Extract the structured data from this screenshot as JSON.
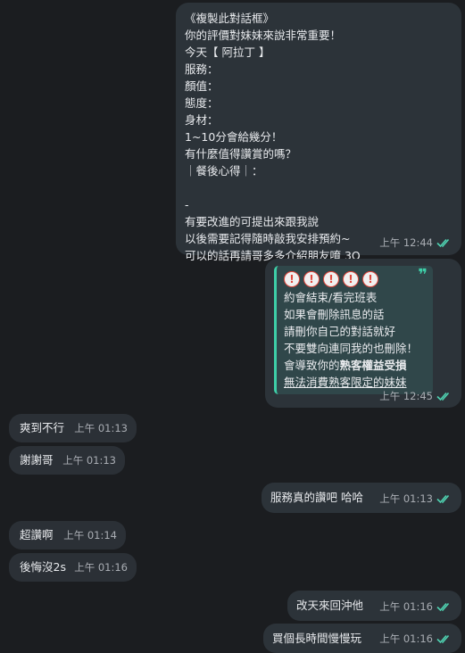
{
  "messages": [
    {
      "id": "msg1",
      "direction": "out",
      "lines": [
        "《複製此對話框》",
        "你的評價對妹妹來說非常重要！",
        "今天【 阿拉丁 】",
        "服務：",
        "顏值：",
        "態度：",
        "身材：",
        "1~10分會給幾分！",
        "有什麼值得讚賞的嗎？",
        "｜餐後心得｜：",
        "",
        "-",
        "有要改進的可提出來跟我說",
        "以後需要記得隨時敲我安排預約~",
        "可以的話再請哥多多介紹朋友唷 3Q"
      ],
      "time": "上午 12:44",
      "read": true
    },
    {
      "id": "msg2",
      "direction": "out",
      "quote_mark": "❞",
      "warn_count": 5,
      "warn_glyph": "!",
      "quote_lines": [
        "約會結束/看完班表",
        "如果會刪除訊息的話",
        "請刪你自己的對話就好",
        "不要雙向連同我的也刪除！"
      ],
      "quote_line5_prefix": "會導致你的",
      "quote_line5_bold": "熟客權益受損",
      "quote_line6": "無法消費熟客限定的妹妹",
      "time": "上午 12:45",
      "read": true
    },
    {
      "id": "msg3",
      "direction": "in",
      "text": "爽到不行",
      "time": "上午 01:13"
    },
    {
      "id": "msg4",
      "direction": "in",
      "text": "謝謝哥",
      "time": "上午 01:13"
    },
    {
      "id": "msg5",
      "direction": "out",
      "text": "服務真的讚吧 哈哈",
      "time": "上午 01:13",
      "read": true
    },
    {
      "id": "msg6",
      "direction": "in",
      "text": "超讚啊",
      "time": "上午 01:14"
    },
    {
      "id": "msg7",
      "direction": "in",
      "text": "後悔沒2s",
      "time": "上午 01:16"
    },
    {
      "id": "msg8",
      "direction": "out",
      "text": "改天來回沖他",
      "time": "上午 01:16",
      "read": true
    },
    {
      "id": "msg9",
      "direction": "out",
      "text": "買個長時間慢慢玩",
      "time": "上午 01:16",
      "read": true
    }
  ],
  "colors": {
    "background": "#1b1d20",
    "bubble": "#2b3036",
    "accent": "#3ecfa8",
    "warning": "#e0463c",
    "read_check": "#4fd1b0"
  },
  "icons": {
    "read_receipt": "double-check-icon",
    "warning": "exclamation-circle-icon",
    "quote": "quote-mark-icon"
  }
}
